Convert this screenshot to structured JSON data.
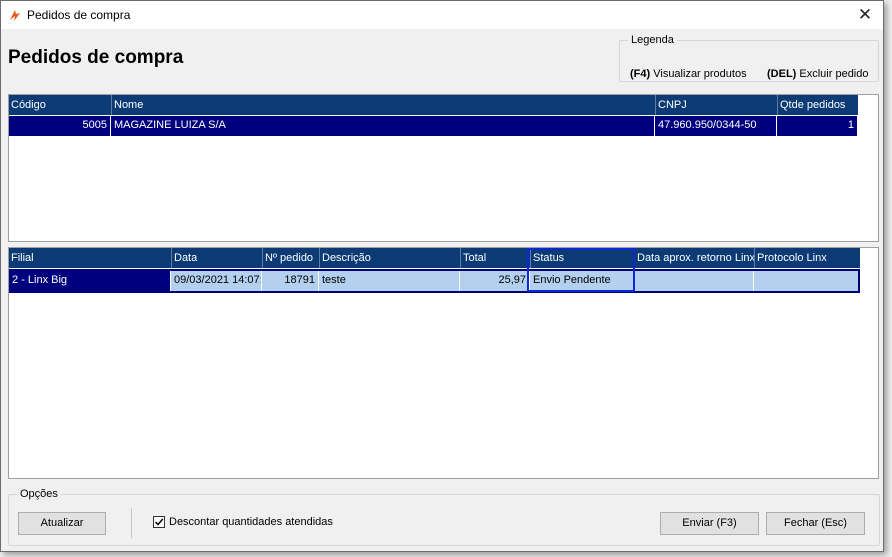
{
  "window": {
    "title": "Pedidos de compra",
    "close_glyph": "✕"
  },
  "header": {
    "title": "Pedidos de compra"
  },
  "legend": {
    "title": "Legenda",
    "items": [
      {
        "key": "(F4)",
        "label": "Visualizar produtos"
      },
      {
        "key": "(DEL)",
        "label": "Excluir pedido"
      }
    ]
  },
  "suppliers_grid": {
    "columns": [
      "Código",
      "Nome",
      "CNPJ",
      "Qtde pedidos"
    ],
    "rows": [
      {
        "codigo": "5005",
        "nome": "MAGAZINE LUIZA S/A",
        "cnpj": "47.960.950/0344-50",
        "qtde": "1"
      }
    ]
  },
  "orders_grid": {
    "columns": [
      "Filial",
      "Data",
      "Nº pedido",
      "Descrição",
      "Total",
      "Status",
      "Data aprox. retorno Linx",
      "Protocolo Linx"
    ],
    "rows": [
      {
        "filial": "2 - Linx Big",
        "data": "09/03/2021 14:07:",
        "numero": "18791",
        "descricao": "teste",
        "total": "25,97",
        "status": "Envio Pendente",
        "data_retorno": "",
        "protocolo": ""
      }
    ]
  },
  "options": {
    "title": "Opções",
    "refresh_label": "Atualizar",
    "discount_label": "Descontar quantidades atendidas",
    "discount_checked": true,
    "send_label": "Enviar (F3)",
    "close_label": "Fechar (Esc)"
  },
  "colors": {
    "grid_header": "#0b3a75",
    "selection_dark": "#00007f",
    "selection_light": "#b4d0ef",
    "status_highlight": "#0a28d8"
  }
}
